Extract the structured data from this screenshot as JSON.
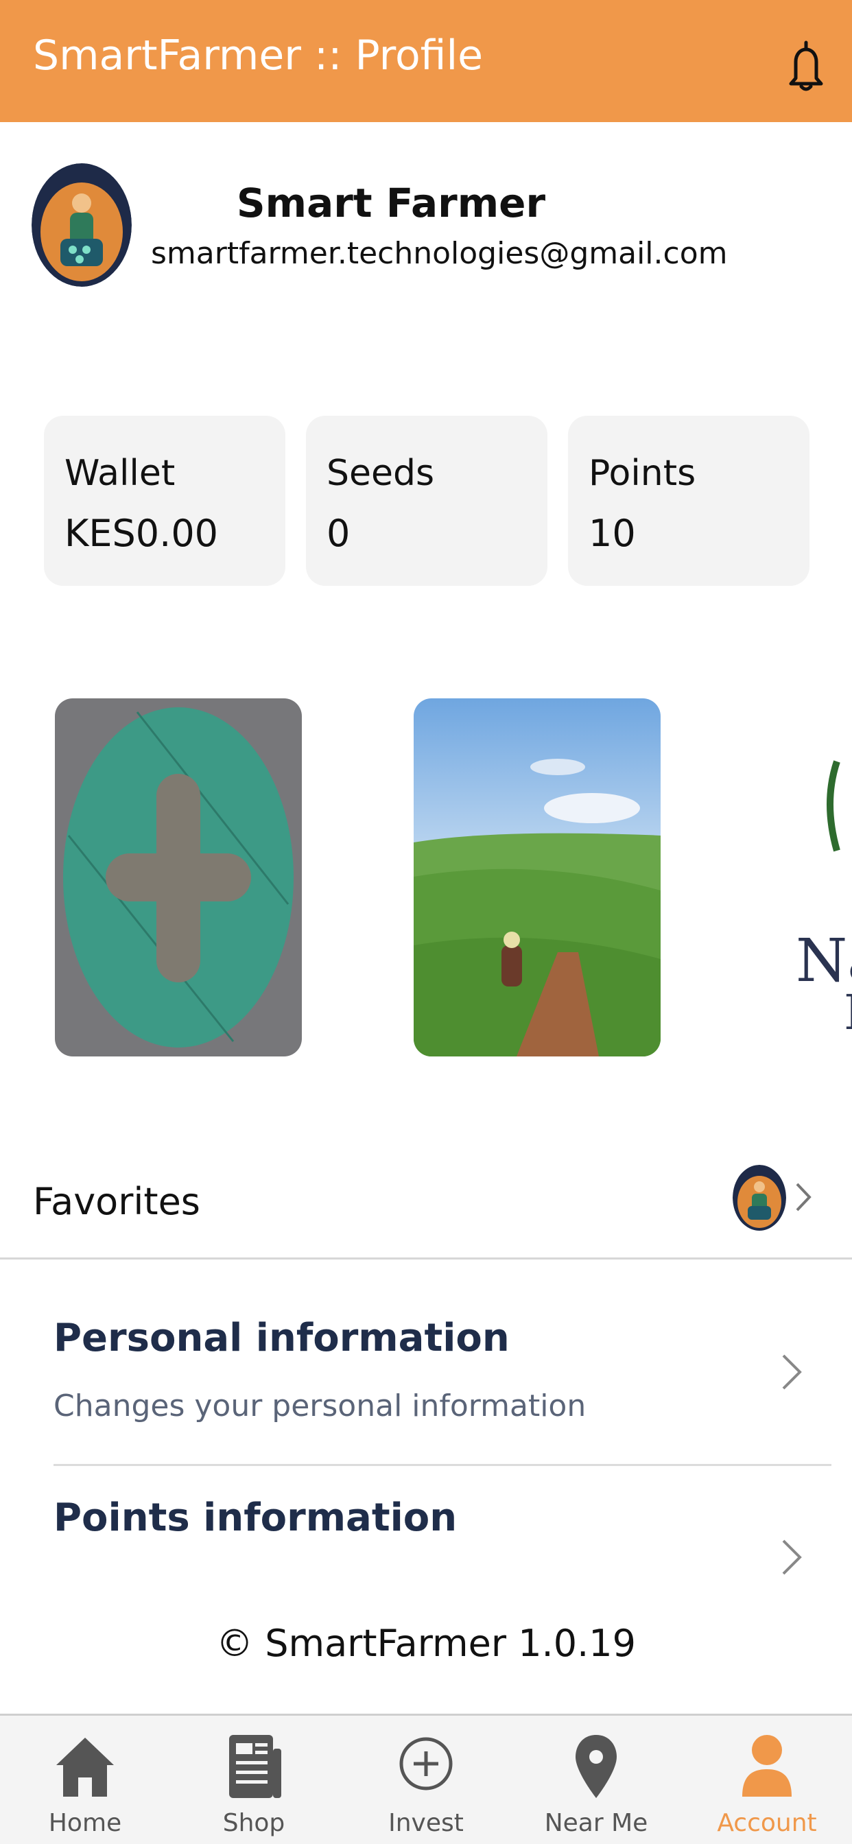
{
  "header": {
    "title": "SmartFarmer :: Profile",
    "icon": "bell-icon"
  },
  "profile": {
    "name": "Smart Farmer",
    "email": "smartfarmer.technologies@gmail.com"
  },
  "stats": [
    {
      "label": "Wallet",
      "value": "KES0.00"
    },
    {
      "label": "Seeds",
      "value": "0"
    },
    {
      "label": "Points",
      "value": "10"
    }
  ],
  "banners": [
    {
      "name": "add-banner",
      "icon": "plus-icon"
    },
    {
      "name": "farm-photo-banner"
    },
    {
      "name": "partner-logo-banner",
      "partial_text": "Na"
    }
  ],
  "favorites": {
    "label": "Favorites"
  },
  "menu": [
    {
      "title": "Personal information",
      "subtitle": "Changes your personal information"
    },
    {
      "title": "Points information"
    }
  ],
  "footer": {
    "copyright": "© SmartFarmer 1.0.19"
  },
  "tabs": [
    {
      "label": "Home",
      "icon": "home-icon"
    },
    {
      "label": "Shop",
      "icon": "newspaper-icon"
    },
    {
      "label": "Invest",
      "icon": "plus-circle-icon"
    },
    {
      "label": "Near Me",
      "icon": "location-pin-icon"
    },
    {
      "label": "Account",
      "icon": "user-icon",
      "active": true
    }
  ],
  "colors": {
    "accent": "#F0984A",
    "menu_title": "#1F2D4A",
    "card_bg": "#F3F3F3"
  }
}
